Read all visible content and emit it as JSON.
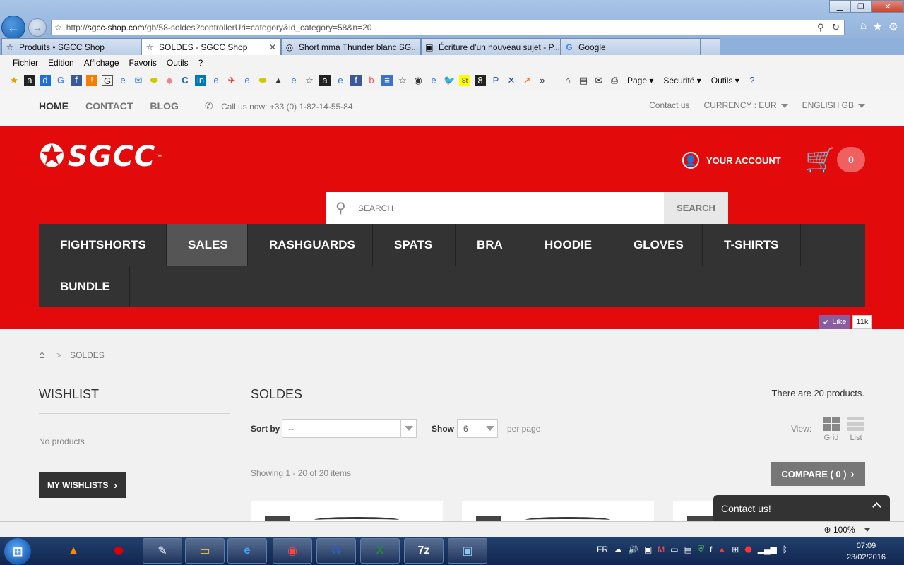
{
  "browser": {
    "url_prefix": "http://",
    "url_domain": "sgcc-shop.com",
    "url_path": "/gb/58-soldes?controllerUri=category&id_category=58&n=20",
    "tabs": [
      {
        "label": "Produits • SGCC Shop",
        "icon": "star-icon"
      },
      {
        "label": "SOLDES - SGCC Shop",
        "icon": "star-icon",
        "active": true
      },
      {
        "label": "Short mma Thunder blanc SG...",
        "icon": "site-icon"
      },
      {
        "label": "Écriture d'un nouveau sujet - P...",
        "icon": "ie-icon"
      },
      {
        "label": "Google",
        "icon": "google-icon"
      }
    ],
    "menu": [
      "Fichier",
      "Edition",
      "Affichage",
      "Favoris",
      "Outils",
      "?"
    ],
    "commands": [
      "Page",
      "Sécurité",
      "Outils"
    ],
    "zoom": "100%"
  },
  "topbar": {
    "nav": [
      "HOME",
      "CONTACT",
      "BLOG"
    ],
    "call_us": "Call us now: +33 (0) 1-82-14-55-84",
    "contact_us": "Contact us",
    "currency": "CURRENCY : EUR",
    "language": "ENGLISH GB"
  },
  "header": {
    "logo_text": "SGCC",
    "account_label": "YOUR ACCOUNT",
    "cart_count": "0",
    "search_placeholder": "SEARCH",
    "search_button": "SEARCH",
    "categories": [
      "FIGHTSHORTS",
      "SALES",
      "RASHGUARDS",
      "SPATS",
      "BRA",
      "HOODIE",
      "GLOVES",
      "T-SHIRTS",
      "BUNDLE"
    ],
    "active_category": "SALES",
    "brand_color": "#e20a0a"
  },
  "like": {
    "label": "Like",
    "count": "11k"
  },
  "breadcrumb": {
    "current": "SOLDES"
  },
  "sidebar": {
    "wishlist_title": "WISHLIST",
    "no_products": "No products",
    "wishlist_button": "MY WISHLISTS"
  },
  "main": {
    "title": "SOLDES",
    "product_count": "There are 20 products.",
    "sort_label": "Sort by",
    "sort_value": "--",
    "show_label": "Show",
    "show_value": "6",
    "per_page": "per page",
    "view_label": "View:",
    "view_grid": "Grid",
    "view_list": "List",
    "showing": "Showing 1 - 20 of 20 items",
    "compare": "COMPARE ( 0 )"
  },
  "contact_widget": {
    "label": "Contact us!"
  },
  "taskbar": {
    "lang": "FR",
    "time": "07:09",
    "date": "23/02/2016"
  }
}
